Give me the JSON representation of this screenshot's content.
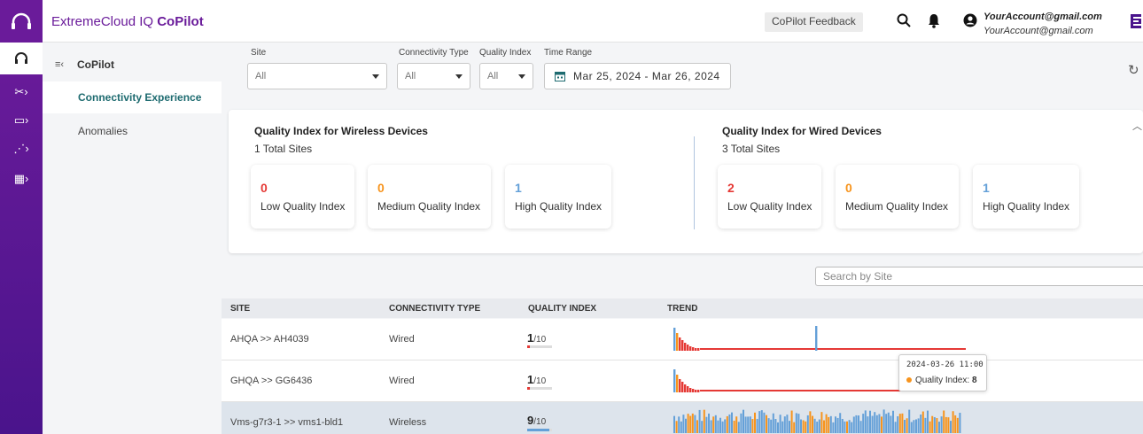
{
  "app": {
    "brand_prefix": "ExtremeCloud IQ",
    "brand_suffix": "CoPilot"
  },
  "header": {
    "feedback_label": "CoPilot Feedback",
    "account_name": "YourAccount@gmail.com",
    "account_email": "YourAccount@gmail.com"
  },
  "nav": {
    "title": "CoPilot",
    "items": [
      {
        "label": "Connectivity Experience",
        "active": true
      },
      {
        "label": "Anomalies",
        "active": false
      }
    ]
  },
  "filters": {
    "site_label": "Site",
    "site_value": "All",
    "connectivity_label": "Connectivity Type",
    "connectivity_value": "All",
    "quality_label": "Quality Index",
    "quality_value": "All",
    "time_label": "Time Range",
    "time_value": "Mar 25, 2024 - Mar 26, 2024"
  },
  "summary": {
    "wireless": {
      "title": "Quality Index for Wireless Devices",
      "total": "1 Total Sites",
      "tiles": [
        {
          "value": "0",
          "label": "Low Quality Index",
          "color": "#e53935"
        },
        {
          "value": "0",
          "label": "Medium Quality Index",
          "color": "#f7941d"
        },
        {
          "value": "1",
          "label": "High Quality Index",
          "color": "#64a0d8"
        }
      ]
    },
    "wired": {
      "title": "Quality Index for Wired Devices",
      "total": "3 Total Sites",
      "tiles": [
        {
          "value": "2",
          "label": "Low Quality Index",
          "color": "#e53935"
        },
        {
          "value": "0",
          "label": "Medium Quality Index",
          "color": "#f7941d"
        },
        {
          "value": "1",
          "label": "High Quality Index",
          "color": "#64a0d8"
        }
      ]
    }
  },
  "search": {
    "placeholder": "Search by Site"
  },
  "table": {
    "headers": {
      "site": "SITE",
      "type": "CONNECTIVITY TYPE",
      "quality": "QUALITY INDEX",
      "trend": "TREND"
    },
    "rows": [
      {
        "site": "AHQA >> AH4039",
        "type": "Wired",
        "qi": "1",
        "qi_max": "/10",
        "qi_fraction": 0.1,
        "qi_color": "#e53935"
      },
      {
        "site": "GHQA >> GG6436",
        "type": "Wired",
        "qi": "1",
        "qi_max": "/10",
        "qi_fraction": 0.1,
        "qi_color": "#e53935"
      },
      {
        "site": "Vms-g7r3-1 >> vms1-bld1",
        "type": "Wireless",
        "qi": "9",
        "qi_max": "/10",
        "qi_fraction": 0.9,
        "qi_color": "#64a0d8"
      }
    ]
  },
  "tooltip": {
    "time": "2024-03-26 11:00",
    "label": "Quality Index:",
    "value": "8"
  },
  "colors": {
    "brand": "#6a1b9a",
    "low": "#e53935",
    "medium": "#f7941d",
    "high": "#64a0d8",
    "accent": "#1e6b70"
  }
}
